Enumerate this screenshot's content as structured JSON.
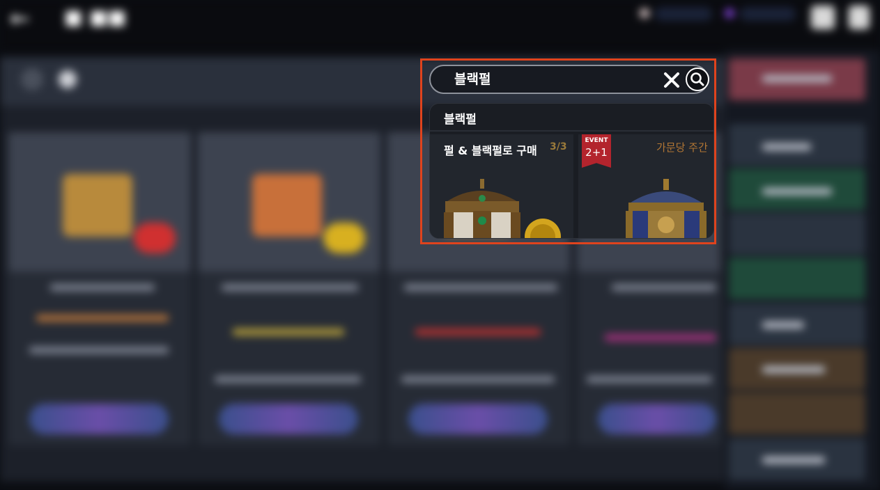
{
  "search": {
    "query": "블랙펄"
  },
  "suggestions": [
    {
      "label": "블랙펄"
    }
  ],
  "results": [
    {
      "title": "펄 & 블랙펄로 구매",
      "count": "3/3"
    },
    {
      "event_tag": "EVENT",
      "event_value": "2+1",
      "shop": "가문당 주간"
    }
  ],
  "colors": {
    "highlight_border": "#e0431d",
    "ribbon": "#b3242d",
    "shop_label": "#b27634"
  },
  "icons": [
    "back-arrow-icon",
    "clear-icon",
    "search-icon",
    "gem-icon",
    "chest-icon"
  ]
}
